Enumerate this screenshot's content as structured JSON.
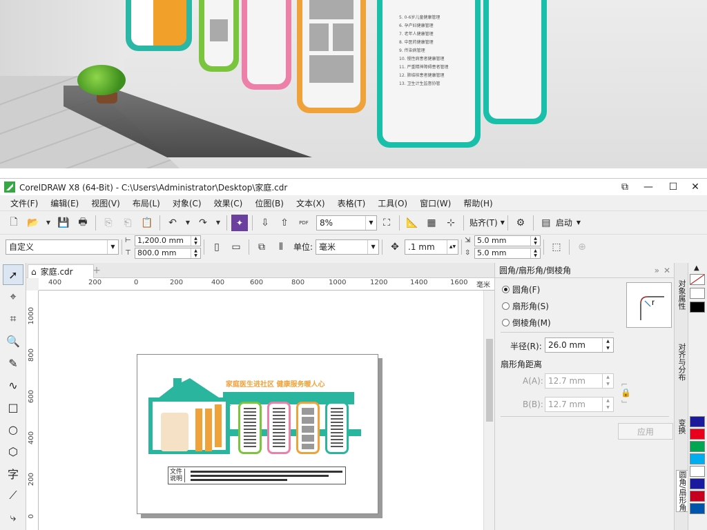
{
  "photo": {
    "panel5_list": [
      "5. 0-6岁儿童健康管理",
      "6. 孕产妇健康管理",
      "7. 老年人健康管理",
      "8. 中医药健康管理",
      "9. 传染病管理",
      "10. 慢性病患者健康管理",
      "11. 严重精神障碍患者管理",
      "12. 肺结核患者健康管理",
      "13. 卫生计生监督协管"
    ]
  },
  "window": {
    "title": "CorelDRAW X8 (64-Bit) - C:\\Users\\Administrator\\Desktop\\家庭.cdr",
    "controls": {
      "restore": "⧉",
      "minimize": "—",
      "maximize": "☐",
      "close": "✕"
    }
  },
  "menu": [
    "文件(F)",
    "编辑(E)",
    "视图(V)",
    "布局(L)",
    "对象(C)",
    "效果(C)",
    "位图(B)",
    "文本(X)",
    "表格(T)",
    "工具(O)",
    "窗口(W)",
    "帮助(H)"
  ],
  "toolbar1": {
    "pdf_label": "PDF",
    "zoom": "8%",
    "snap_label": "贴齐(T)",
    "launch_label": "启动"
  },
  "toolbar2": {
    "preset": "自定义",
    "width": "1,200.0 mm",
    "height": "800.0 mm",
    "unit_label": "单位:",
    "unit": "毫米",
    "nudge": ".1 mm",
    "dup_x": "5.0 mm",
    "dup_y": "5.0 mm"
  },
  "doc_tab": {
    "name": "家庭.cdr",
    "add": "+"
  },
  "ruler": {
    "h_ticks": [
      "400",
      "200",
      "0",
      "200",
      "400",
      "600",
      "800",
      "1000",
      "1200",
      "1400",
      "1600",
      "毫米"
    ],
    "v_ticks": [
      "1000",
      "800",
      "600",
      "400",
      "200",
      "0"
    ]
  },
  "design": {
    "slogan": "家庭医生进社区 健康服务暖人心",
    "explain_label": "文件说明",
    "card_colors": [
      "#7bc43d",
      "#ec80a8",
      "#f0a23a",
      "#2ab59f"
    ]
  },
  "docker": {
    "title": "圆角/扇形角/倒棱角",
    "options": [
      {
        "label": "圆角(F)",
        "selected": true
      },
      {
        "label": "扇形角(S)",
        "selected": false
      },
      {
        "label": "倒棱角(M)",
        "selected": false
      }
    ],
    "radius_label": "半径(R):",
    "radius": "26.0 mm",
    "scallop_label": "扇形角距离",
    "a_label": "A(A):",
    "a_value": "12.7 mm",
    "b_label": "B(B):",
    "b_value": "12.7 mm",
    "apply": "应用",
    "preview_letter": "r"
  },
  "side_tabs": [
    "对象属性",
    "对齐与分布",
    "变换",
    "圆角/扇形角"
  ],
  "palette": {
    "colors": [
      "#ffffff",
      "#000000",
      "#1a1a9a",
      "#e8001c",
      "#00a651",
      "#00aeef",
      "#ffffff",
      "#1a1aa0",
      "#c80020",
      "#0055aa"
    ]
  }
}
